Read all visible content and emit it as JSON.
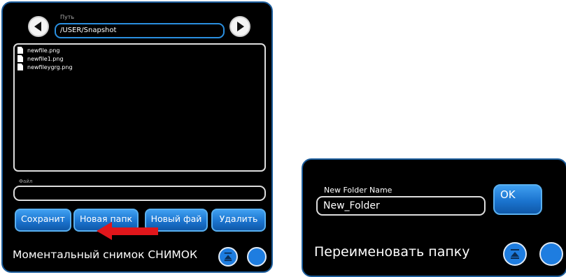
{
  "left_dialog": {
    "path_label": "Путь",
    "path_value": "/USER/Snapshot",
    "files": [
      "newfile.png",
      "newfile1.png",
      "newfileygrg.png"
    ],
    "file_label": "Файл",
    "file_value": "",
    "buttons": {
      "save": "Сохранит",
      "new_folder": "Новая папк",
      "new_file": "Новый фай",
      "delete": "Удалить"
    },
    "title": "Моментальный снимок СНИМОК"
  },
  "right_dialog": {
    "new_folder_label": "New Folder Name",
    "new_folder_value": "New_Folder",
    "ok_label": "OK",
    "title": "Переименовать папку"
  },
  "colors": {
    "accent_blue": "#1e7de0",
    "panel_border": "#1c5d9c",
    "arrow_red": "#e0161b"
  },
  "icons": {
    "back": "arrow-left-icon",
    "forward": "arrow-right-icon",
    "file": "file-icon",
    "eject": "eject-icon",
    "blank_round": "circle-button"
  }
}
